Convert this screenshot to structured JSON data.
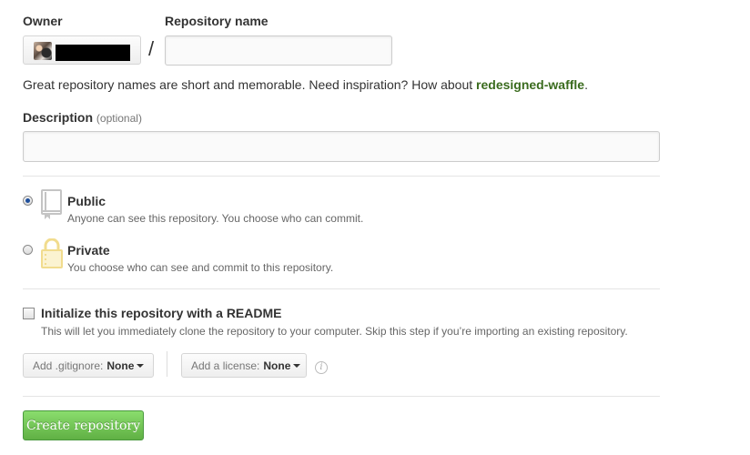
{
  "owner": {
    "label": "Owner"
  },
  "repository_name": {
    "label": "Repository name",
    "value": "",
    "separator": "/"
  },
  "hint": {
    "text": "Great repository names are short and memorable. Need inspiration? How about ",
    "suggestion": "redesigned-waffle",
    "suffix": "."
  },
  "description": {
    "label": "Description",
    "optional": "(optional)",
    "value": ""
  },
  "visibility": {
    "public": {
      "title": "Public",
      "note": "Anyone can see this repository. You choose who can commit.",
      "checked": true
    },
    "private": {
      "title": "Private",
      "note": "You choose who can see and commit to this repository.",
      "checked": false
    }
  },
  "readme": {
    "title": "Initialize this repository with a README",
    "note": "This will let you immediately clone the repository to your computer. Skip this step if you’re importing an existing repository.",
    "checked": false
  },
  "gitignore": {
    "label": "Add .gitignore:",
    "value": "None"
  },
  "license": {
    "label": "Add a license:",
    "value": "None"
  },
  "info_icon": "i",
  "create_button": {
    "label": "Create repository",
    "color": "#60b044"
  },
  "colors": {
    "link_green": "#3a6b1e",
    "radio_selected": "#1e4f9c"
  }
}
